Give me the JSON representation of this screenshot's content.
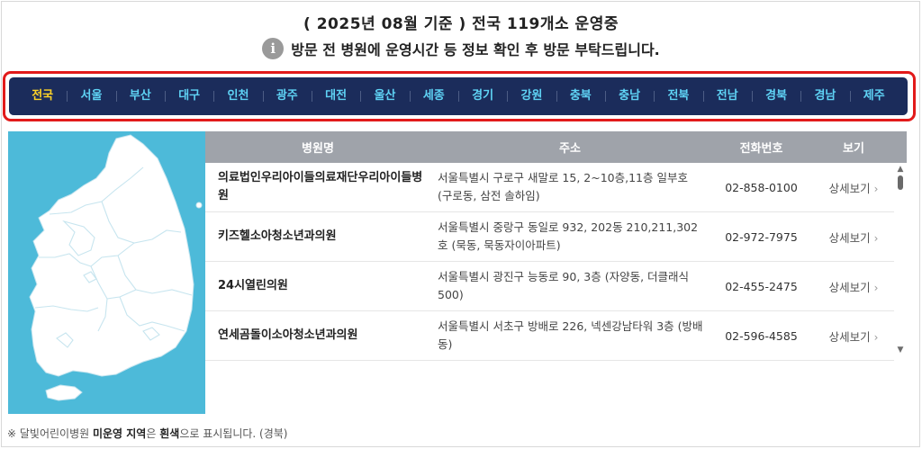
{
  "headline": "( 2025년 08월 기준 ) 전국 119개소 운영중",
  "notice": {
    "icon": "info-icon",
    "text": "방문 전 병원에 운영시간 등 정보 확인 후 방문 부탁드립니다."
  },
  "regions": {
    "active": "전국",
    "active_color": "#ffd427",
    "tab_color": "#5fd3f5",
    "bar_color": "#1b2c5b",
    "items": [
      "전국",
      "서울",
      "부산",
      "대구",
      "인천",
      "광주",
      "대전",
      "울산",
      "세종",
      "경기",
      "강원",
      "충북",
      "충남",
      "전북",
      "전남",
      "경북",
      "경남",
      "제주"
    ]
  },
  "map": {
    "sea_color": "#4dbad9",
    "land_color": "#ffffff"
  },
  "table": {
    "header_color": "#9fa3aa",
    "headers": {
      "name": "병원명",
      "address": "주소",
      "phone": "전화번호",
      "view": "보기"
    },
    "rows": [
      {
        "name": "의료법인우리아이들의료재단우리아이들병원",
        "address": "서울특별시 구로구 새말로 15, 2~10층,11층 일부호 (구로동, 삼전 솔하임)",
        "phone": "02-858-0100",
        "view": "상세보기"
      },
      {
        "name": "키즈헬소아청소년과의원",
        "address": "서울특별시 중랑구 동일로 932, 202동 210,211,302호 (묵동, 묵동자이아파트)",
        "phone": "02-972-7975",
        "view": "상세보기"
      },
      {
        "name": "24시열린의원",
        "address": "서울특별시 광진구 능동로 90, 3층 (자양동, 더클래식500)",
        "phone": "02-455-2475",
        "view": "상세보기"
      },
      {
        "name": "연세곰돌이소아청소년과의원",
        "address": "서울특별시 서초구 방배로 226, 넥센강남타워 3층 (방배동)",
        "phone": "02-596-4585",
        "view": "상세보기"
      }
    ]
  },
  "footnote": {
    "prefix": "※ 달빛어린이병원 ",
    "bold1": "미운영 지역",
    "mid": "은 ",
    "bold2": "흰색",
    "suffix": "으로 표시됩니다. (경북)"
  }
}
